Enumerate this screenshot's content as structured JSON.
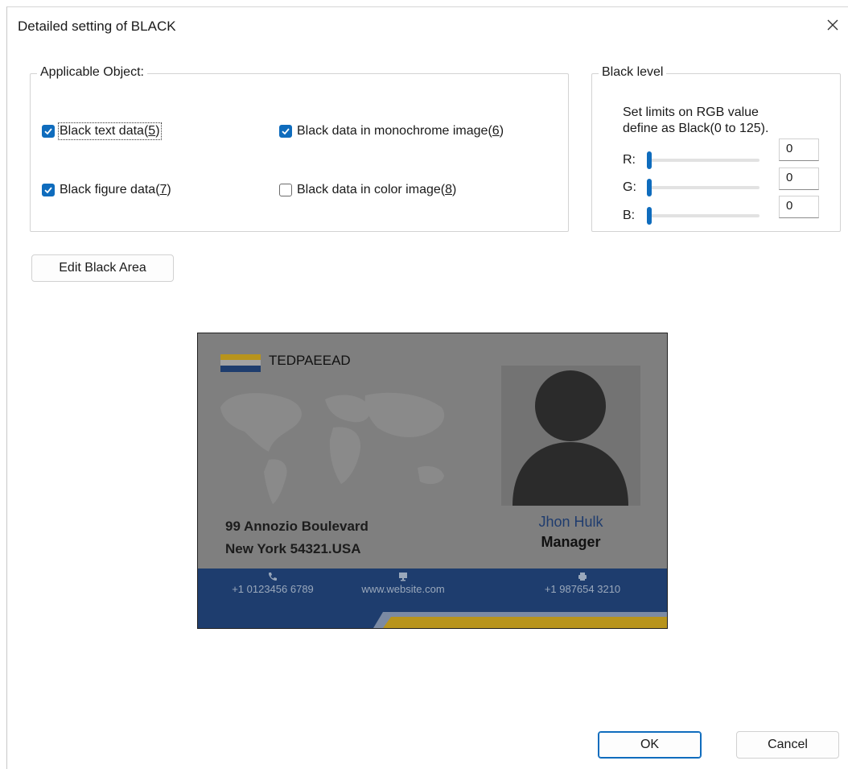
{
  "window": {
    "title": "Detailed setting of BLACK",
    "close_icon": "close-icon"
  },
  "applicable": {
    "legend": "Applicable Object:",
    "items": [
      {
        "label": "Black text data",
        "key": "5",
        "checked": true
      },
      {
        "label": "Black data in monochrome image",
        "key": "6",
        "checked": true
      },
      {
        "label": "Black figure data",
        "key": "7",
        "checked": true
      },
      {
        "label": "Black data in color image",
        "key": "8",
        "checked": false
      }
    ]
  },
  "black_level": {
    "legend": "Black level",
    "desc_line1": "Set limits on RGB value",
    "desc_line2": "define as Black(0 to 125).",
    "channels": [
      {
        "label": "R:",
        "value": "0"
      },
      {
        "label": "G:",
        "value": "0"
      },
      {
        "label": "B:",
        "value": "0"
      }
    ]
  },
  "edit_button": "Edit Black Area",
  "preview": {
    "company": "TEDPAEEAD",
    "address_line1": "99 Annozio Boulevard",
    "address_line2": "New York 54321.USA",
    "person_name": "Jhon Hulk",
    "person_role": "Manager",
    "phone": "+1 0123456 6789",
    "website": "www.website.com",
    "fax": "+1 987654 3210",
    "colors": {
      "accent_blue": "#1e3d6e",
      "accent_gold": "#b8941c"
    }
  },
  "buttons": {
    "ok": "OK",
    "cancel": "Cancel"
  }
}
